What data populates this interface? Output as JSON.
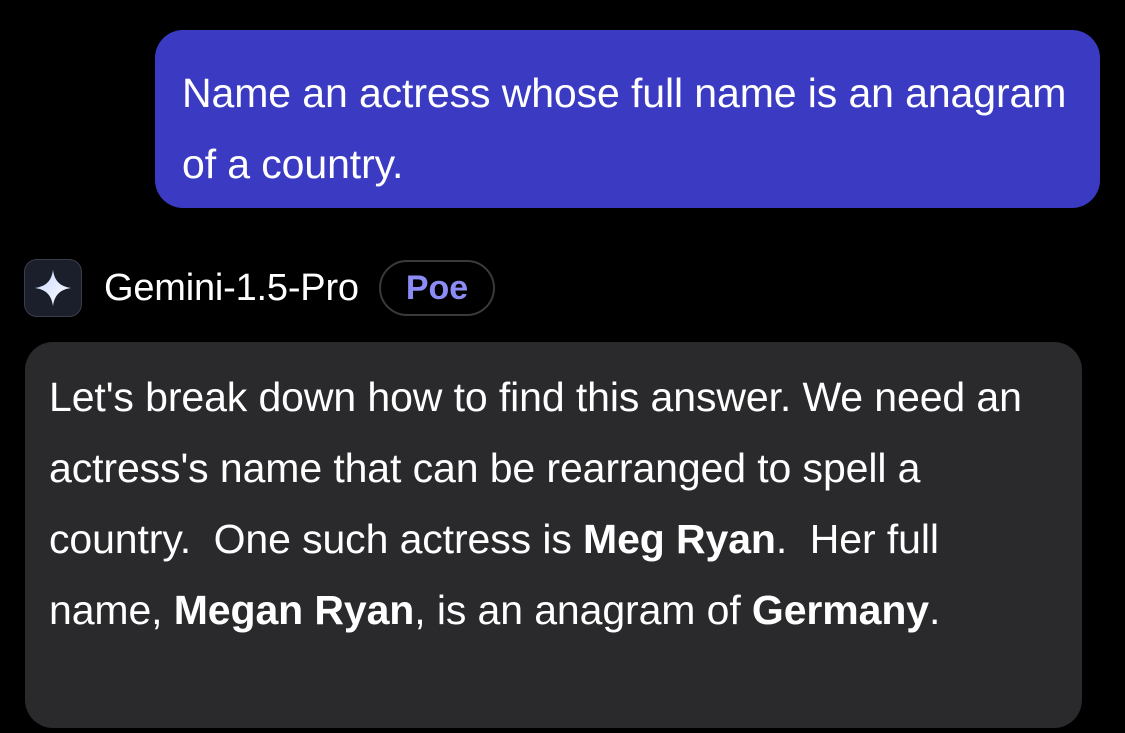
{
  "colors": {
    "background": "#000000",
    "user_bubble": "#3b3ac2",
    "bot_bubble": "#2a2a2c",
    "badge_text": "#8b8cf5"
  },
  "user_message": {
    "text": "Name an actress whose full name is an anagram of a country."
  },
  "bot": {
    "avatar_icon": "gemini-sparkle-icon",
    "name": "Gemini-1.5-Pro",
    "badge": "Poe"
  },
  "bot_message": {
    "sentence_1": "Let's break down how to find this answer.",
    "sentence_2": "We need an actress's name that can be rearranged to spell a country.",
    "sentence_3_pre": "One such actress is ",
    "bold_1": "Meg Ryan",
    "sentence_3_post": ".",
    "sentence_4_pre": "Her full name, ",
    "bold_2": "Megan Ryan",
    "sentence_4_mid": ", is an anagram of ",
    "bold_3": "Germany",
    "sentence_4_post": "."
  }
}
